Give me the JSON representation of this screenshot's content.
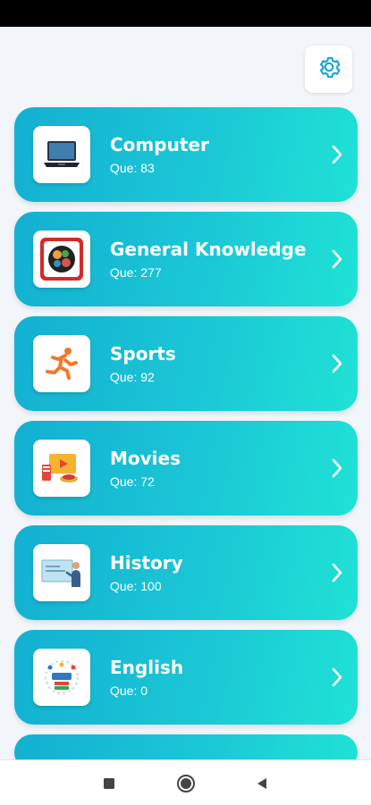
{
  "settings": {
    "icon": "gear-icon",
    "accent": "#19a7cf"
  },
  "categories": [
    {
      "title": "Computer",
      "count": "Que: 83",
      "icon": "laptop-icon"
    },
    {
      "title": "General Knowledge",
      "count": "Que: 277",
      "icon": "brain-icon"
    },
    {
      "title": "Sports",
      "count": "Que: 92",
      "icon": "runner-icon"
    },
    {
      "title": "Movies",
      "count": "Que: 72",
      "icon": "film-icon"
    },
    {
      "title": "History",
      "count": "Que: 100",
      "icon": "teacher-board-icon"
    },
    {
      "title": "English",
      "count": "Que: 0",
      "icon": "english-books-icon"
    }
  ],
  "colors": {
    "card_start": "#13b0d1",
    "card_end": "#1fe2d5",
    "background": "#f2f6fb"
  },
  "navigation": {
    "recents": "recents-square-icon",
    "home": "home-circle-icon",
    "back": "back-triangle-icon"
  }
}
